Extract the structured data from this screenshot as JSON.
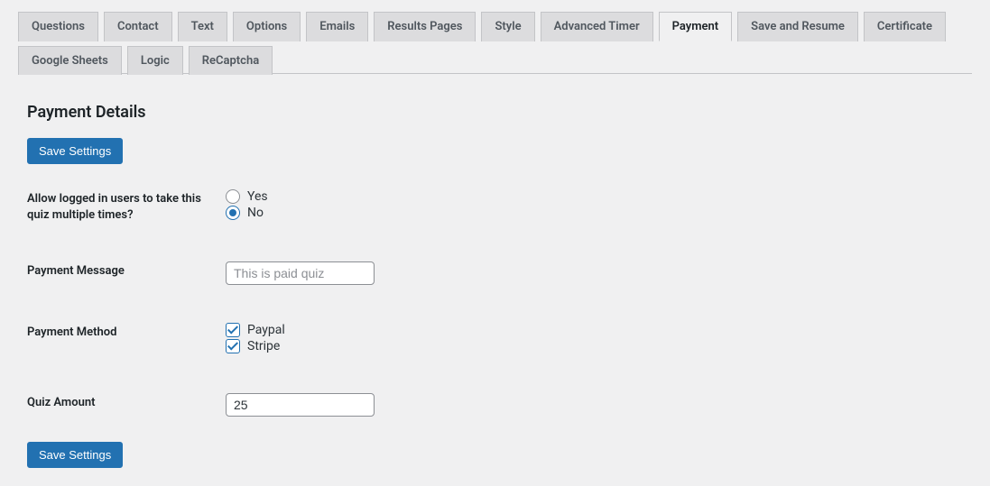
{
  "tabs": {
    "row1": [
      "Questions",
      "Contact",
      "Text",
      "Options",
      "Emails",
      "Results Pages",
      "Style",
      "Advanced Timer",
      "Payment",
      "Save and Resume",
      "Certificate"
    ],
    "row2": [
      "Google Sheets",
      "Logic",
      "ReCaptcha"
    ],
    "active": "Payment"
  },
  "section": {
    "title": "Payment Details"
  },
  "buttons": {
    "save": "Save Settings"
  },
  "fields": {
    "allow_multiple": {
      "label": "Allow logged in users to take this quiz multiple times?",
      "yes": "Yes",
      "no": "No",
      "value": "no"
    },
    "payment_message": {
      "label": "Payment Message",
      "placeholder": "This is paid quiz",
      "value": ""
    },
    "payment_method": {
      "label": "Payment Method",
      "paypal": "Paypal",
      "stripe": "Stripe",
      "paypal_checked": true,
      "stripe_checked": true
    },
    "quiz_amount": {
      "label": "Quiz Amount",
      "value": "25"
    }
  }
}
